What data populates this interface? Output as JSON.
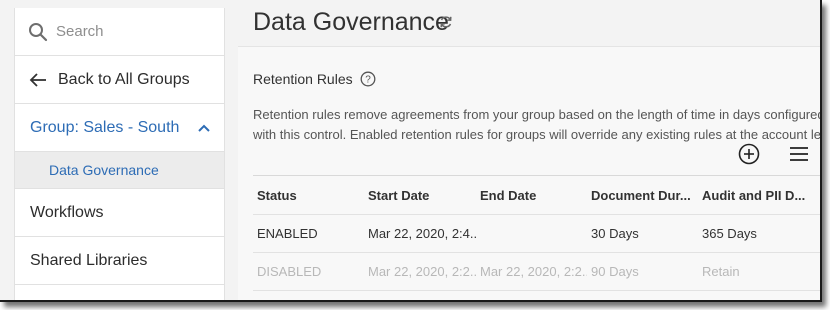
{
  "sidebar": {
    "search_placeholder": "Search",
    "back_label": "Back to All Groups",
    "group_label": "Group: Sales - South",
    "sub_item_label": "Data Governance",
    "items": [
      {
        "label": "Workflows"
      },
      {
        "label": "Shared Libraries"
      }
    ]
  },
  "main": {
    "title": "Data Governance",
    "section_title": "Retention Rules",
    "description_line1": "Retention rules remove agreements from your group based on the length of time in days configured",
    "description_line2": "with this control. Enabled retention rules for groups will override any existing rules at the account level.",
    "table": {
      "headers": [
        "Status",
        "Start Date",
        "End Date",
        "Document Dur...",
        "Audit and PII D..."
      ],
      "rows": [
        [
          "ENABLED",
          "Mar 22, 2020, 2:4...",
          "",
          "30 Days",
          "365 Days"
        ],
        [
          "DISABLED",
          "Mar 22, 2020, 2:2...",
          "Mar 22, 2020, 2:2...",
          "90 Days",
          "Retain"
        ]
      ]
    }
  },
  "icons": {
    "search": "search-icon",
    "back": "arrow-left-icon",
    "collapse": "chevron-up-icon",
    "refresh": "refresh-icon",
    "help": "help-circle-icon",
    "add": "plus-circle-icon",
    "menu": "hamburger-menu-icon"
  },
  "colors": {
    "accent": "#2d6cb5",
    "disabled_text": "#b8b8b8",
    "background": "#f3f3f3"
  }
}
